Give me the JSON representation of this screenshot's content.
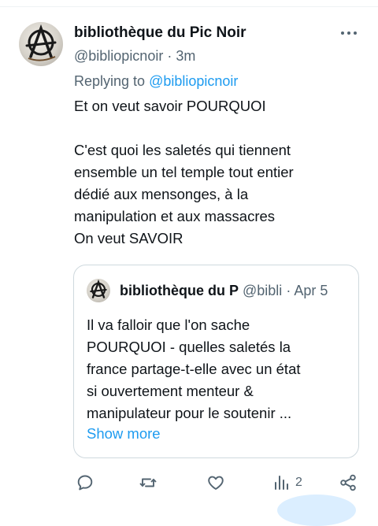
{
  "tweet": {
    "author_name": "bibliothèque du Pic Noir",
    "handle": "@bibliopicnoir",
    "separator": "·",
    "time": "3m",
    "replying_prefix": "Replying to",
    "replying_handle": "@bibliopicnoir",
    "body_lines": [
      "Et on veut savoir POURQUOI",
      "",
      "C'est quoi les saletés qui tiennent",
      "ensemble un tel temple tout entier",
      "dédié aux mensonges, à la",
      "manipulation et aux massacres",
      "On veut SAVOIR"
    ]
  },
  "quote": {
    "author_name": "bibliothèque du Pic Noir",
    "handle": "@bibli",
    "separator": "·",
    "date": "Apr 5",
    "body_lines": [
      "Il va falloir que l'on sache",
      "POURQUOI - quelles saletés la",
      "france partage-t-elle avec un état",
      "si ouvertement menteur &",
      "manipulateur pour le soutenir ..."
    ],
    "show_more": "Show more"
  },
  "actions": {
    "reply_icon": "reply-icon",
    "retweet_icon": "retweet-icon",
    "like_icon": "heart-icon",
    "views_icon": "analytics-icon",
    "views_count": "2",
    "share_icon": "share-icon"
  },
  "colors": {
    "link": "#1d9bf0",
    "secondary_text": "#536471",
    "border": "#cfd9de"
  }
}
